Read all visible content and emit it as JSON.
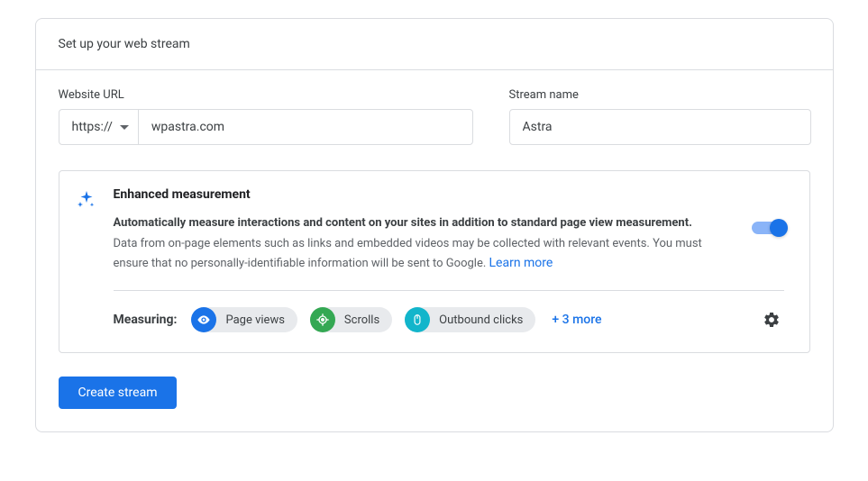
{
  "header": {
    "title": "Set up your web stream"
  },
  "form": {
    "url_label": "Website URL",
    "protocol": "https://",
    "url_value": "wpastra.com",
    "stream_label": "Stream name",
    "stream_value": "Astra"
  },
  "enhanced": {
    "title": "Enhanced measurement",
    "desc_bold": "Automatically measure interactions and content on your sites in addition to standard page view measurement.",
    "desc_plain": "Data from on-page elements such as links and embedded videos may be collected with relevant events. You must ensure that no personally-identifiable information will be sent to Google. ",
    "learn_more": "Learn more",
    "toggle_on": true,
    "measuring_label": "Measuring:",
    "chips": [
      {
        "label": "Page views",
        "icon": "eye",
        "color": "blue"
      },
      {
        "label": "Scrolls",
        "icon": "target",
        "color": "green"
      },
      {
        "label": "Outbound clicks",
        "icon": "mouse",
        "color": "cyan"
      }
    ],
    "more_link": "+ 3 more"
  },
  "actions": {
    "create": "Create stream"
  }
}
